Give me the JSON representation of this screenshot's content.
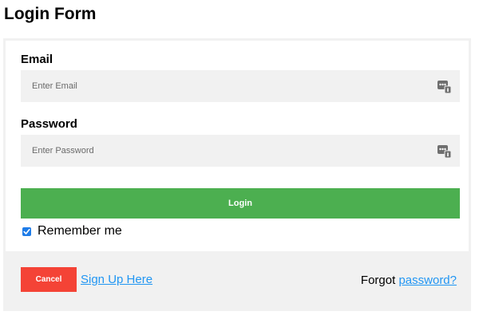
{
  "page": {
    "title": "Login Form"
  },
  "form": {
    "email": {
      "label": "Email",
      "placeholder": "Enter Email",
      "value": ""
    },
    "password": {
      "label": "Password",
      "placeholder": "Enter Password",
      "value": ""
    },
    "login_label": "Login",
    "remember": {
      "label": "Remember me",
      "checked": true
    }
  },
  "footer": {
    "cancel_label": "Cancel",
    "signup_label": "Sign Up Here",
    "forgot_prefix": "Forgot",
    "forgot_link_label": "password?"
  },
  "icons": {
    "field_icon": "key-fill-icon",
    "checkbox_icon": "check-icon"
  },
  "colors": {
    "login_button": "#4caf50",
    "cancel_button": "#f44336",
    "link": "#2196f3",
    "checkbox": "#1e7ce8",
    "input_background": "#f1f1f1",
    "footer_background": "#f1f1f1"
  }
}
